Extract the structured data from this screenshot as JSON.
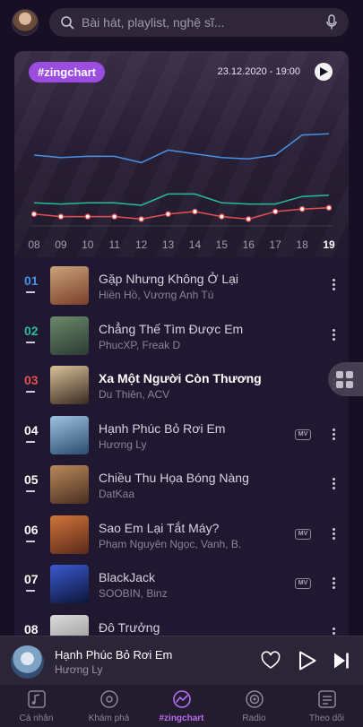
{
  "search": {
    "placeholder": "Bài hát, playlist, nghệ sĩ..."
  },
  "chart": {
    "badge": "#zingchart",
    "datetime": "23.12.2020 - 19:00",
    "active_hour": "19"
  },
  "chart_data": {
    "type": "line",
    "x": [
      "08",
      "09",
      "10",
      "11",
      "12",
      "13",
      "14",
      "15",
      "16",
      "17",
      "18",
      "19"
    ],
    "series": [
      {
        "color": "#4a90e2",
        "values": [
          60,
          58,
          59,
          59,
          54,
          64,
          61,
          58,
          57,
          60,
          76,
          77
        ]
      },
      {
        "color": "#27bd9c",
        "values": [
          22,
          21,
          22,
          22,
          20,
          29,
          29,
          22,
          21,
          21,
          27,
          28
        ]
      },
      {
        "color": "#e35050",
        "values": [
          13,
          11,
          11,
          11,
          9,
          13,
          15,
          11,
          9,
          15,
          17,
          18
        ]
      }
    ],
    "ylim": [
      0,
      100
    ],
    "grid": false,
    "legend": "none"
  },
  "songs": [
    {
      "rank": "01",
      "rank_color": "#4a90e2",
      "title": "Gặp Nhưng Không Ở Lại",
      "artist": "Hiền Hồ, Vương Anh Tú",
      "mv": false,
      "bold": false,
      "thumb": [
        "#c9a47a",
        "#7a3d2a"
      ]
    },
    {
      "rank": "02",
      "rank_color": "#27bd9c",
      "title": "Chẳng Thế Tìm Được Em",
      "artist": "PhucXP, Freak D",
      "mv": false,
      "bold": false,
      "thumb": [
        "#6b8a6a",
        "#2c3a33"
      ]
    },
    {
      "rank": "03",
      "rank_color": "#e35050",
      "title": "Xa Một Người Còn Thương",
      "artist": "Du Thiên, ACV",
      "mv": false,
      "bold": true,
      "thumb": [
        "#d9c39a",
        "#3a2a22"
      ]
    },
    {
      "rank": "04",
      "rank_color": "#ffffff",
      "title": "Hạnh Phúc Bỏ Rơi Em",
      "artist": "Hương Ly",
      "mv": true,
      "mv_label": "MV",
      "bold": false,
      "thumb": [
        "#9ec3e0",
        "#2a4c6e"
      ]
    },
    {
      "rank": "05",
      "rank_color": "#ffffff",
      "title": "Chiều Thu Họa Bóng Nàng",
      "artist": "DatKaa",
      "mv": false,
      "bold": false,
      "thumb": [
        "#b98a5a",
        "#4a2e22"
      ]
    },
    {
      "rank": "06",
      "rank_color": "#ffffff",
      "title": "Sao Em Lại Tắt Máy?",
      "artist": "Phạm Nguyên Ngọc, Vanh, B.",
      "mv": true,
      "mv_label": "MV",
      "bold": false,
      "thumb": [
        "#d0743a",
        "#5a2a1a"
      ]
    },
    {
      "rank": "07",
      "rank_color": "#ffffff",
      "title": "BlackJack",
      "artist": "SOOBIN, Binz",
      "mv": true,
      "mv_label": "MV",
      "bold": false,
      "thumb": [
        "#3a5ad0",
        "#0e1538"
      ]
    },
    {
      "rank": "08",
      "rank_color": "#ffffff",
      "title": "Đô Trưởng",
      "artist": "",
      "mv": false,
      "bold": false,
      "thumb": [
        "#dcdcdc",
        "#8a8a8a"
      ]
    }
  ],
  "player": {
    "title": "Hạnh Phúc Bỏ Rơi Em",
    "artist": "Hương Ly"
  },
  "nav": [
    {
      "label": "Cá nhân",
      "icon": "music-library-icon",
      "active": false
    },
    {
      "label": "Khám phá",
      "icon": "disc-icon",
      "active": false
    },
    {
      "label": "#zingchart",
      "icon": "chart-icon",
      "active": true
    },
    {
      "label": "Radio",
      "icon": "radio-icon",
      "active": false
    },
    {
      "label": "Theo dõi",
      "icon": "feed-icon",
      "active": false
    }
  ],
  "colors": {
    "accent": "#9b4de0",
    "background": "#170f23"
  }
}
